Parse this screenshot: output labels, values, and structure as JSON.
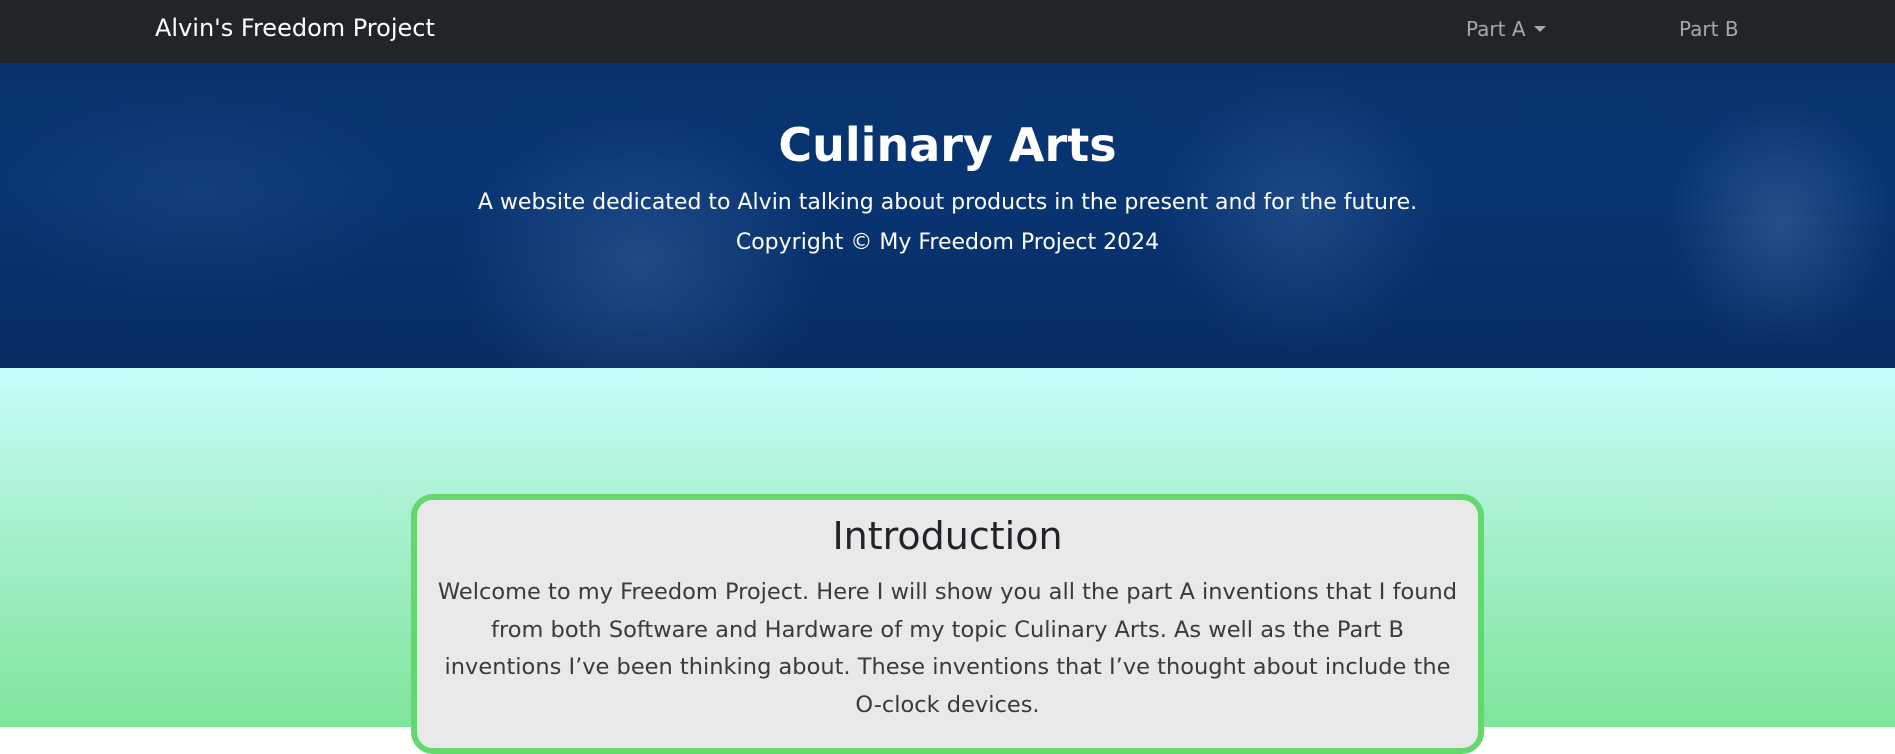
{
  "navbar": {
    "brand": "Alvin's Freedom Project",
    "items": [
      {
        "label": "Part A",
        "has_dropdown": true
      },
      {
        "label": "Part B",
        "has_dropdown": false
      }
    ]
  },
  "hero": {
    "title": "Culinary Arts",
    "subtitle": "A website dedicated to Alvin talking about products in the present and for the future.",
    "copyright": "Copyright © My Freedom Project 2024"
  },
  "intro": {
    "title": "Introduction",
    "body": "Welcome to my Freedom Project. Here I will show you all the part A inventions that I found from both Software and Hardware of my topic Culinary Arts. As well as the Part B inventions I’ve been thinking about. These inventions that I’ve thought about include the O-clock devices."
  },
  "colors": {
    "navbar_bg": "#212529",
    "hero_overlay": "#0a3166",
    "card_border": "#62d86e",
    "card_bg": "#e9e9e9",
    "gradient_top": "#c8fdfb",
    "gradient_bottom": "#7fe59b"
  }
}
